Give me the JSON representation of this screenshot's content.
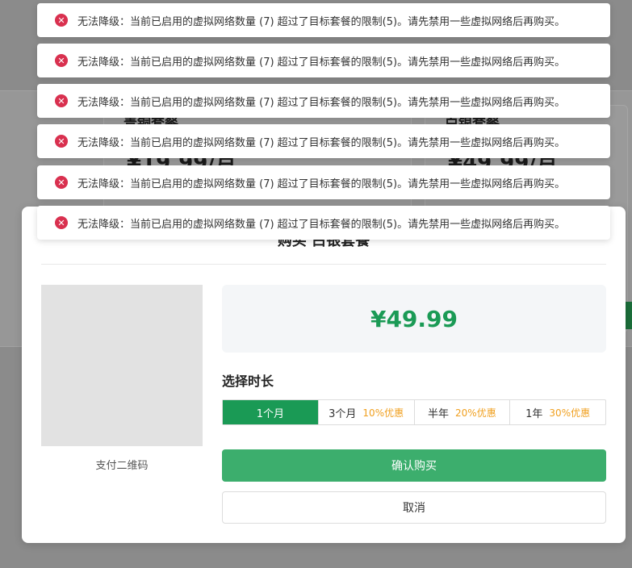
{
  "background": {
    "card_left_title": "青铜套餐",
    "card_left_price": "¥19.99/月",
    "card_right_title": "白银套餐",
    "card_right_price": "¥49.99/月"
  },
  "toasts": [
    {
      "icon": "error-icon",
      "message": "无法降级：当前已启用的虚拟网络数量 (7) 超过了目标套餐的限制(5)。请先禁用一些虚拟网络后再购买。"
    },
    {
      "icon": "error-icon",
      "message": "无法降级：当前已启用的虚拟网络数量 (7) 超过了目标套餐的限制(5)。请先禁用一些虚拟网络后再购买。"
    },
    {
      "icon": "error-icon",
      "message": "无法降级：当前已启用的虚拟网络数量 (7) 超过了目标套餐的限制(5)。请先禁用一些虚拟网络后再购买。"
    },
    {
      "icon": "error-icon",
      "message": "无法降级：当前已启用的虚拟网络数量 (7) 超过了目标套餐的限制(5)。请先禁用一些虚拟网络后再购买。"
    },
    {
      "icon": "error-icon",
      "message": "无法降级：当前已启用的虚拟网络数量 (7) 超过了目标套餐的限制(5)。请先禁用一些虚拟网络后再购买。"
    },
    {
      "icon": "error-icon",
      "message": "无法降级：当前已启用的虚拟网络数量 (7) 超过了目标套餐的限制(5)。请先禁用一些虚拟网络后再购买。"
    }
  ],
  "modal": {
    "title": "购买 白银套餐",
    "qr_label": "支付二维码",
    "price": "¥49.99",
    "duration_label": "选择时长",
    "durations": [
      {
        "label": "1个月",
        "discount": "",
        "active": true
      },
      {
        "label": "3个月",
        "discount": "10%优惠",
        "active": false
      },
      {
        "label": "半年",
        "discount": "20%优惠",
        "active": false
      },
      {
        "label": "1年",
        "discount": "30%优惠",
        "active": false
      }
    ],
    "confirm_label": "确认购买",
    "cancel_label": "取消"
  },
  "colors": {
    "accent_green": "#1a9a55",
    "confirm_green": "#3cae6d",
    "discount_orange": "#f0a020",
    "error_red": "#d9304f"
  }
}
